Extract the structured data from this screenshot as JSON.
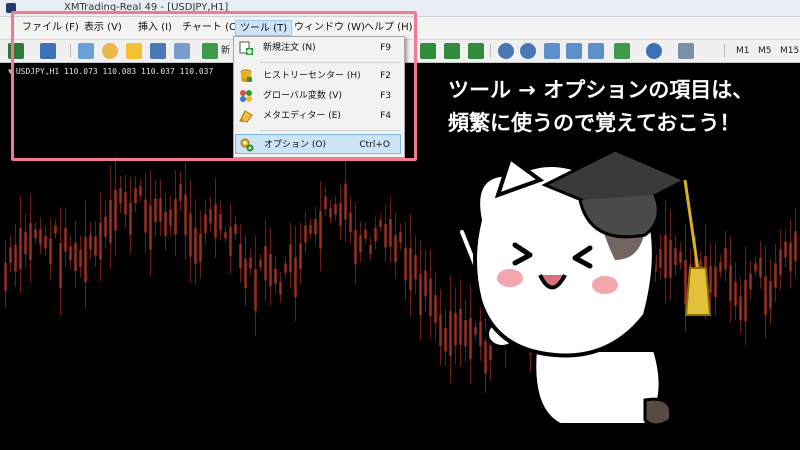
{
  "window": {
    "title": "XMTrading-Real 49 - [USDJPY,H1]"
  },
  "menubar": {
    "items": [
      {
        "label": "ファイル (F)"
      },
      {
        "label": "表示 (V)"
      },
      {
        "label": "挿入 (I)"
      },
      {
        "label": "チャート (C)"
      },
      {
        "label": "ツール (T)"
      },
      {
        "label": "ウィンドウ (W)"
      },
      {
        "label": "ヘルプ (H)"
      }
    ]
  },
  "toolbar": {
    "partial_label": "新",
    "timeframes": [
      "M1",
      "M5",
      "M15"
    ]
  },
  "chart": {
    "info": "USDJPY,H1  110.073 110.083 110.037 110.037"
  },
  "tools_menu": {
    "items": [
      {
        "label": "新規注文 (N)",
        "shortcut": "F9",
        "icon": "new-order-icon"
      },
      {
        "label": "ヒストリーセンター (H)",
        "shortcut": "F2",
        "icon": "history-center-icon"
      },
      {
        "label": "グローバル変数 (V)",
        "shortcut": "F3",
        "icon": "global-variables-icon"
      },
      {
        "label": "メタエディター (E)",
        "shortcut": "F4",
        "icon": "metaeditor-icon"
      },
      {
        "label": "オプション (O)",
        "shortcut": "Ctrl+O",
        "icon": "options-icon",
        "highlighted": true
      }
    ]
  },
  "caption": {
    "line1": "ツール → オプションの項目は、",
    "line2": "頻繁に使うので覚えておこう！"
  },
  "colors": {
    "highlight_frame": "#f07b8b",
    "menu_hover": "#cce4f7",
    "chart_background": "#000000",
    "candle_red": "#c0392b"
  }
}
